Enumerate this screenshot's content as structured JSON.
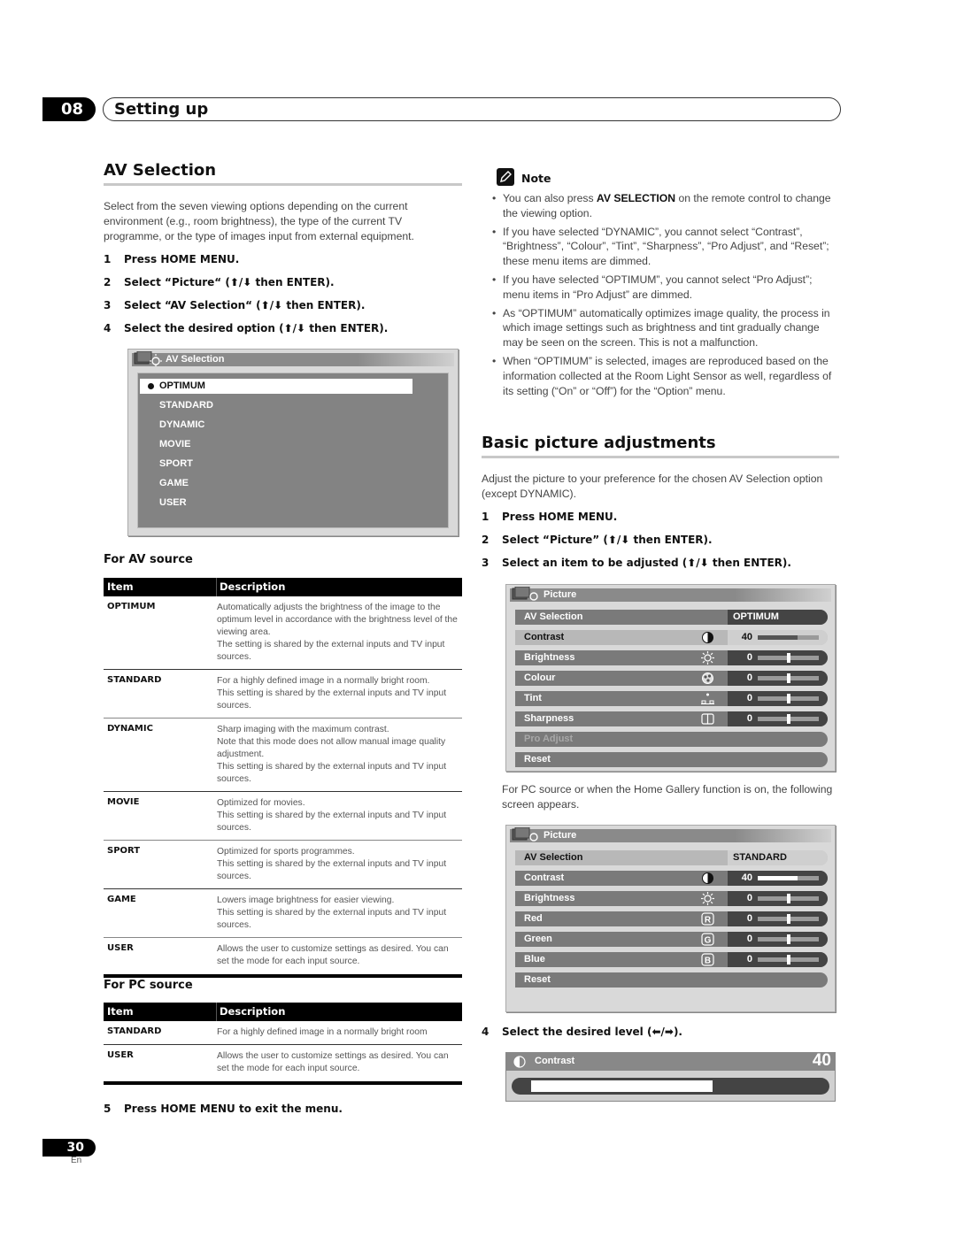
{
  "header": {
    "chapter_number": "08",
    "chapter_title": "Setting up"
  },
  "av_selection": {
    "heading": "AV Selection",
    "intro": "Select from the seven viewing options depending on the current environment (e.g., room brightness), the type of the current TV programme, or the type of images input from external equipment.",
    "steps": [
      {
        "num": "1",
        "text": "Press HOME MENU."
      },
      {
        "num": "2",
        "text": "Select “Picture“ (⬆/⬇ then ENTER)."
      },
      {
        "num": "3",
        "text": "Select “AV Selection“ (⬆/⬇ then ENTER)."
      },
      {
        "num": "4",
        "text": "Select the desired option (⬆/⬇ then ENTER)."
      }
    ],
    "osd": {
      "title": "AV Selection",
      "options": [
        "OPTIMUM",
        "STANDARD",
        "DYNAMIC",
        "MOVIE",
        "SPORT",
        "GAME",
        "USER"
      ],
      "selected": "OPTIMUM"
    },
    "av_source": {
      "heading": "For AV source",
      "columns": [
        "Item",
        "Description"
      ],
      "rows": [
        {
          "item": "OPTIMUM",
          "desc": "Automatically adjusts the brightness of the image to the optimum level in accordance with the brightness level of the viewing area.\nThe setting is shared by the external inputs and TV input sources."
        },
        {
          "item": "STANDARD",
          "desc": "For a highly defined image in a normally bright room.\nThis setting is shared by the external inputs and TV input sources."
        },
        {
          "item": "DYNAMIC",
          "desc": "Sharp imaging with the maximum contrast.\nNote that this mode does not allow manual image quality adjustment.\nThis setting is shared by the external inputs and TV input sources."
        },
        {
          "item": "MOVIE",
          "desc": "Optimized for movies.\nThis setting is shared by the external inputs and TV input sources."
        },
        {
          "item": "SPORT",
          "desc": "Optimized for sports programmes.\nThis setting is shared by the external inputs and TV input sources."
        },
        {
          "item": "GAME",
          "desc": "Lowers image brightness for easier viewing.\nThis setting is shared by the external inputs and TV input sources."
        },
        {
          "item": "USER",
          "desc": "Allows the user to customize settings as desired. You can set the mode for each input source."
        }
      ]
    },
    "pc_source": {
      "heading": "For PC source",
      "columns": [
        "Item",
        "Description"
      ],
      "rows": [
        {
          "item": "STANDARD",
          "desc": "For a highly defined image in a normally bright room"
        },
        {
          "item": "USER",
          "desc": "Allows the user to customize settings as desired. You can set the mode for each input source."
        }
      ]
    },
    "final_step": {
      "num": "5",
      "text": "Press HOME MENU to exit the menu."
    }
  },
  "note": {
    "label": "Note",
    "items": [
      {
        "pre": "You can also press ",
        "bold": "AV SELECTION",
        "post": " on the remote control to change the viewing option."
      },
      {
        "pre": "If you have selected “DYNAMIC”, you cannot select “Contrast”, “Brightness”, “Colour”, “Tint”, “Sharpness”, “Pro Adjust”, and “Reset”; these menu items are dimmed.",
        "bold": "",
        "post": ""
      },
      {
        "pre": "If you have selected “OPTIMUM”, you cannot select “Pro Adjust”; menu items in “Pro Adjust” are dimmed.",
        "bold": "",
        "post": ""
      },
      {
        "pre": "As “OPTIMUM” automatically optimizes image quality, the process in which image settings such as brightness and tint gradually change may be seen on the screen. This is not a malfunction.",
        "bold": "",
        "post": ""
      },
      {
        "pre": "When “OPTIMUM” is selected, images are reproduced based on the information collected at the Room Light Sensor as well, regardless of its setting (“On” or “Off”) for the “Option” menu.",
        "bold": "",
        "post": ""
      }
    ]
  },
  "basic_picture": {
    "heading": "Basic picture adjustments",
    "intro": "Adjust the picture to your preference for the chosen AV Selection option (except DYNAMIC).",
    "steps": [
      {
        "num": "1",
        "text": "Press HOME MENU."
      },
      {
        "num": "2",
        "text": "Select “Picture” (⬆/⬇ then ENTER)."
      },
      {
        "num": "3",
        "text": "Select an item to be adjusted (⬆/⬇ then ENTER)."
      }
    ],
    "osd_av": {
      "title": "Picture",
      "rows": [
        {
          "label": "AV Selection",
          "value": "OPTIMUM",
          "type": "text"
        },
        {
          "label": "Contrast",
          "icon": "contrast-icon",
          "value": "40",
          "type": "bar",
          "level": 0.65,
          "highlight": true
        },
        {
          "label": "Brightness",
          "icon": "brightness-icon",
          "value": "0",
          "type": "center"
        },
        {
          "label": "Colour",
          "icon": "colour-icon",
          "value": "0",
          "type": "center"
        },
        {
          "label": "Tint",
          "icon": "tint-icon",
          "value": "0",
          "type": "center"
        },
        {
          "label": "Sharpness",
          "icon": "sharpness-icon",
          "value": "0",
          "type": "center"
        },
        {
          "label": "Pro Adjust",
          "type": "none",
          "dimmed": true
        },
        {
          "label": "Reset",
          "type": "none"
        }
      ]
    },
    "pc_note": "For PC source or when the Home Gallery function is on, the following screen appears.",
    "osd_pc": {
      "title": "Picture",
      "rows": [
        {
          "label": "AV Selection",
          "value": "STANDARD",
          "type": "text",
          "highlight": true
        },
        {
          "label": "Contrast",
          "icon": "contrast-icon",
          "value": "40",
          "type": "bar",
          "level": 0.65
        },
        {
          "label": "Brightness",
          "icon": "brightness-icon",
          "value": "0",
          "type": "center"
        },
        {
          "label": "Red",
          "icon": "red-icon",
          "glyph": "R",
          "value": "0",
          "type": "center"
        },
        {
          "label": "Green",
          "icon": "green-icon",
          "glyph": "G",
          "value": "0",
          "type": "center"
        },
        {
          "label": "Blue",
          "icon": "blue-icon",
          "glyph": "B",
          "value": "0",
          "type": "center"
        },
        {
          "label": "Reset",
          "type": "none"
        }
      ]
    },
    "step4": {
      "num": "4",
      "text": "Select the desired level (⬅/➡)."
    },
    "level_osd": {
      "label": "Contrast",
      "value": "40",
      "level": 0.65
    }
  },
  "footer": {
    "page_number": "30",
    "language": "En"
  }
}
